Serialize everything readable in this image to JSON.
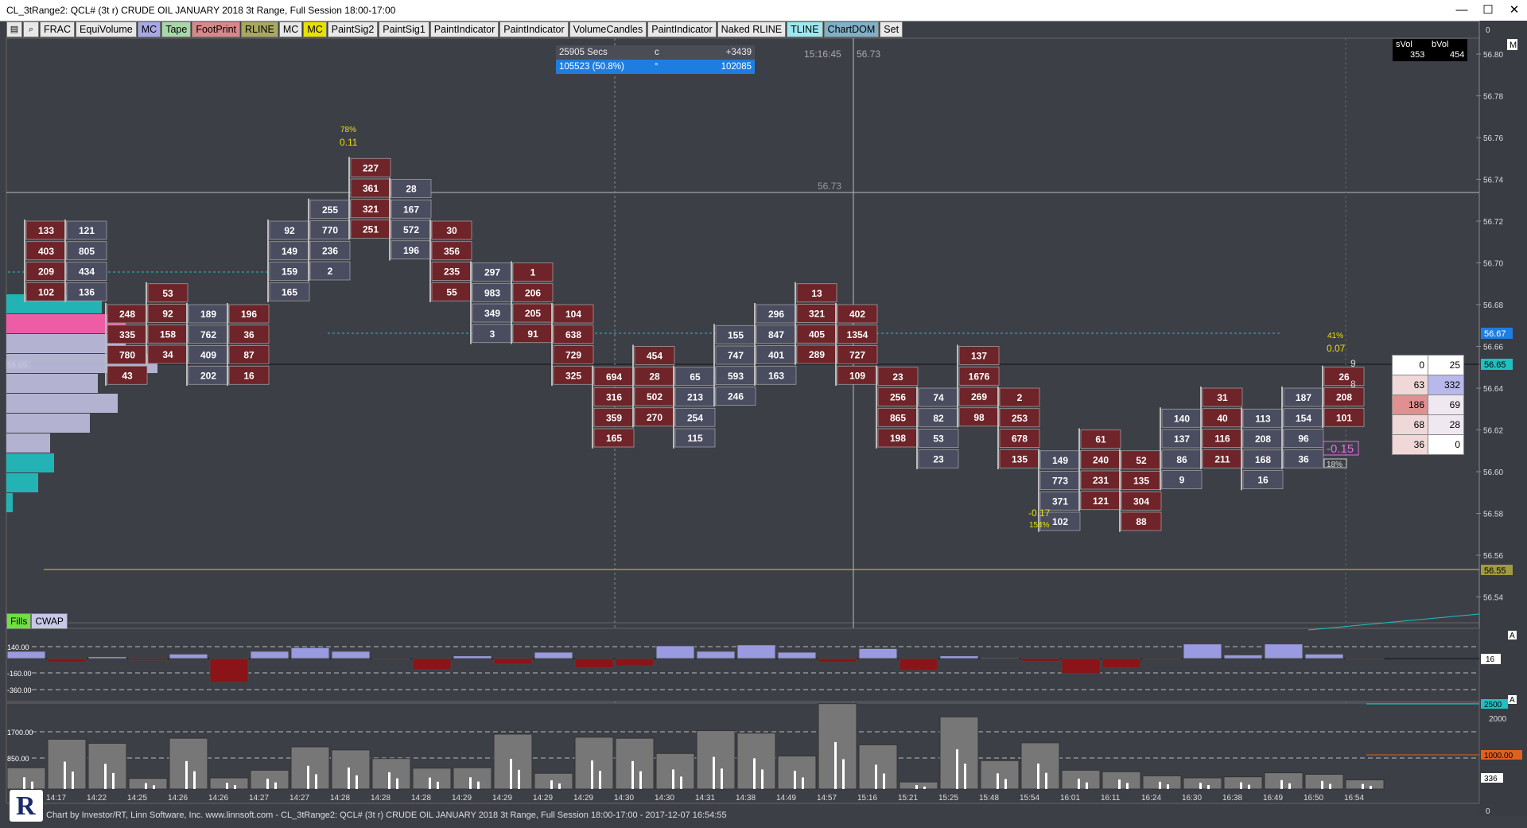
{
  "window": {
    "title": "CL_3tRange2: QCL# (3t r) CRUDE OIL JANUARY 2018 3t Range, Full Session 18:00-17:00",
    "minimize": "—",
    "maximize": "☐",
    "close": "✕"
  },
  "toolbar": {
    "icons": [
      "chart-icon",
      "zoom-icon"
    ],
    "buttons": [
      {
        "label": "FRAC",
        "bg": "#e8e8e8"
      },
      {
        "label": "EquiVolume",
        "bg": "#e8e8e8"
      },
      {
        "label": "MC",
        "bg": "#a8a8e8"
      },
      {
        "label": "Tape",
        "bg": "#a8d8a8"
      },
      {
        "label": "FootPrint",
        "bg": "#d88888"
      },
      {
        "label": "RLINE",
        "bg": "#a8a860"
      },
      {
        "label": "MC",
        "bg": "#e8e8e8"
      },
      {
        "label": "MC",
        "bg": "#e8e000"
      },
      {
        "label": "PaintSig2",
        "bg": "#e8e8e8"
      },
      {
        "label": "PaintSig1",
        "bg": "#e8e8e8"
      },
      {
        "label": "PaintIndicator",
        "bg": "#e8e8e8"
      },
      {
        "label": "PaintIndicator",
        "bg": "#e8e8e8"
      },
      {
        "label": "VolumeCandles",
        "bg": "#e8e8e8"
      },
      {
        "label": "PaintIndicator",
        "bg": "#e8e8e8"
      },
      {
        "label": "Naked RLINE",
        "bg": "#e8e8e8"
      },
      {
        "label": "TLINE",
        "bg": "#9ee8f0"
      },
      {
        "label": "ChartDOM",
        "bg": "#7fb0c8"
      },
      {
        "label": "Set",
        "bg": "#e8e8e8"
      }
    ]
  },
  "colors": {
    "background": "#3d3f47",
    "up_cell": "#4a4c60",
    "down_cell": "#6e2428",
    "cyan": "#20c0c0",
    "pink": "#ff60b0",
    "lavender": "#c0c0e0",
    "olive": "#a09a40"
  },
  "stats_box": {
    "row1": {
      "a": "25905 Secs",
      "b": "c",
      "c": "+3439"
    },
    "row2": {
      "a": "105523 (50.8%)",
      "b": "°",
      "c": "102085"
    }
  },
  "crosshair": {
    "time": "15:16:45",
    "price": "56.73",
    "label": "56.73"
  },
  "svbv": {
    "svol_label": "sVol",
    "bvol_label": "bVol",
    "svol": "353",
    "bvol": "454"
  },
  "price_axis": {
    "labels": [
      "0",
      "56.80",
      "56.78",
      "56.76",
      "56.74",
      "56.72",
      "56.70",
      "56.68",
      "56.66",
      "56.64",
      "56.62",
      "56.60",
      "56.58",
      "56.56",
      "56.54"
    ],
    "m_label": "M",
    "tags": {
      "current": "56.65",
      "blue": "56.67",
      "olive": "56.55",
      "left": "56.65"
    }
  },
  "dom_table": [
    [
      "0",
      "25"
    ],
    [
      "63",
      "332"
    ],
    [
      "186",
      "69"
    ],
    [
      "68",
      "28"
    ],
    [
      "36",
      "0"
    ]
  ],
  "annotations": {
    "pct_top": "78%",
    "delta_top": "0.11",
    "pct_low": "154%",
    "delta_low": "-0.17",
    "pct_right": "41%",
    "delta_right": "0.07",
    "delta_box": "-0.15",
    "pct_box": "18%",
    "right_side_9": "9",
    "right_side_8": "8"
  },
  "footprint_cells": {
    "c0": [
      "133",
      "403",
      "209",
      "102"
    ],
    "c1": [
      "121",
      "805",
      "434",
      "136"
    ],
    "c2": [
      "248",
      "335",
      "780",
      "43"
    ],
    "c3": [
      "53",
      "92",
      "158",
      "34"
    ],
    "c4": [
      "189",
      "762",
      "409",
      "202"
    ],
    "c5": [
      "196",
      "36",
      "87",
      "16"
    ],
    "c6": [
      "92",
      "149",
      "159",
      "165"
    ],
    "c7": [
      "255",
      "770",
      "236",
      "2"
    ],
    "c8": [
      "227",
      "361",
      "321",
      "251"
    ],
    "c9": [
      "28",
      "167",
      "572",
      "196"
    ],
    "c10": [
      "30",
      "356",
      "235",
      "55"
    ],
    "c11": [
      "297",
      "983",
      "349",
      "3"
    ],
    "c12": [
      "1",
      "206",
      "205",
      "91"
    ],
    "c13": [
      "104",
      "638",
      "729",
      "325"
    ],
    "c14": [
      "694",
      "316",
      "359",
      "165"
    ],
    "c15": [
      "454",
      "28",
      "502",
      "270"
    ],
    "c16": [
      "65",
      "213",
      "254",
      "115"
    ],
    "c17": [
      "155",
      "747",
      "593",
      "246"
    ],
    "c18": [
      "296",
      "847",
      "401",
      "163"
    ],
    "c19": [
      "13",
      "321",
      "405",
      "289"
    ],
    "c20": [
      "402",
      "1354",
      "727",
      "109"
    ],
    "c21": [
      "23",
      "256",
      "865",
      "198"
    ],
    "c22": [
      "74",
      "82",
      "53",
      "23"
    ],
    "c23": [
      "137",
      "1676",
      "269",
      "98"
    ],
    "c24": [
      "2",
      "253",
      "678",
      "135"
    ],
    "c25": [
      "149",
      "773",
      "371",
      "102"
    ],
    "c26": [
      "61",
      "240",
      "231",
      "121"
    ],
    "c27": [
      "52",
      "135",
      "304",
      "88"
    ],
    "c28": [
      "140",
      "137",
      "86",
      "9"
    ],
    "c29": [
      "31",
      "40",
      "116",
      "211"
    ],
    "c30": [
      "113",
      "208",
      "168",
      "16"
    ],
    "c31": [
      "187",
      "154",
      "96",
      "36"
    ],
    "c32": [
      "26",
      "208",
      "101"
    ]
  },
  "delta_panel": {
    "labels": [
      "140.00",
      "-160.00",
      "-360.00"
    ],
    "right_tag": "16",
    "a_label": "A",
    "values": [
      40,
      -20,
      10,
      -10,
      25,
      -130,
      40,
      60,
      40,
      -5,
      -60,
      15,
      -30,
      35,
      -50,
      -40,
      70,
      40,
      75,
      35,
      -20,
      55,
      -65,
      15,
      5,
      -15,
      -80,
      -50,
      -5,
      80,
      20,
      80,
      25,
      -5
    ]
  },
  "volume_panel": {
    "labels": [
      "1700.00",
      "850.00",
      "2500",
      "2000",
      "1000.00",
      "336",
      "0"
    ],
    "a_label": "A",
    "values": [
      420,
      980,
      900,
      210,
      1000,
      220,
      370,
      830,
      770,
      600,
      410,
      420,
      1080,
      310,
      1020,
      1000,
      700,
      1150,
      1100,
      650,
      1680,
      870,
      140,
      1420,
      560,
      910,
      370,
      340,
      260,
      220,
      240,
      320,
      290,
      180
    ]
  },
  "time_axis": [
    "14:17",
    "14:22",
    "14:25",
    "14:26",
    "14:26",
    "14:27",
    "14:27",
    "14:28",
    "14:28",
    "14:28",
    "14:29",
    "14:29",
    "14:29",
    "14:29",
    "14:30",
    "14:30",
    "14:31",
    "14:38",
    "14:49",
    "14:57",
    "15:16",
    "15:21",
    "15:25",
    "15:48",
    "15:54",
    "16:01",
    "16:11",
    "16:24",
    "16:30",
    "16:38",
    "16:49",
    "16:50",
    "16:54"
  ],
  "indicator_buttons": [
    {
      "label": "Fills",
      "bg": "#70e040"
    },
    {
      "label": "CWAP",
      "bg": "#c8c8e8"
    }
  ],
  "footer": "Chart by Investor/RT, Linn Software, Inc. www.linnsoft.com - CL_3tRange2: QCL# (3t r) CRUDE OIL JANUARY 2018 3t Range, Full Session 18:00-17:00 - 2017-12-07 16:54:55",
  "logo_letter": "R"
}
